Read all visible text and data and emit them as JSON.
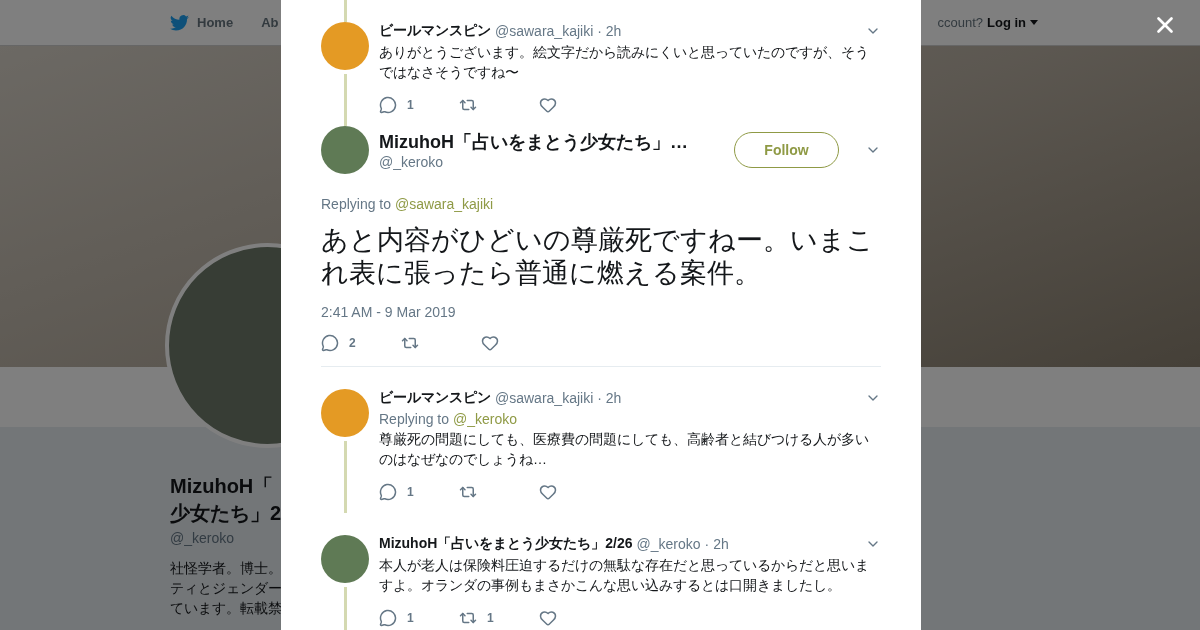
{
  "background": {
    "nav": {
      "home": "Home",
      "about": "Ab",
      "account_prompt": "ccount?",
      "login": "Log in"
    },
    "profile": {
      "name_lines": [
        "MizuhoH「",
        "少女たち」2"
      ],
      "handle": "@_keroko",
      "bio_lines": [
        "社怪学者。博士。",
        "ティとジェンダー",
        "ています。転載禁"
      ]
    }
  },
  "tweets": [
    {
      "kind": "reply",
      "color": "#e49a24",
      "thread_above": true,
      "thread_below": true,
      "name": "ビールマンスピン",
      "handle": "@sawara_kajiki",
      "time": "· 2h",
      "text": "ありがとうございます。絵文字だから読みにくいと思っていたのですが、そうではなさそうですね〜",
      "replies": "1"
    },
    {
      "kind": "main",
      "color": "#5f7a55",
      "name": "MizuhoH「占いをまとう少女たち」…",
      "handle": "@_keroko",
      "follow": "Follow",
      "replying_label": "Replying to",
      "replying_handle": "@sawara_kajiki",
      "text": "あと内容がひどいの尊厳死ですねー。いまこれ表に張ったら普通に燃える案件。",
      "timestamp": "2:41 AM - 9 Mar 2019",
      "replies": "2"
    },
    {
      "kind": "reply",
      "color": "#e49a24",
      "thread_above": false,
      "thread_below": true,
      "name": "ビールマンスピン",
      "handle": "@sawara_kajiki",
      "time": "· 2h",
      "replying_label": "Replying to",
      "replying_handle": "@_keroko",
      "text": "尊厳死の問題にしても、医療費の問題にしても、高齢者と結びつける人が多いのはなぜなのでしょうね…",
      "replies": "1"
    },
    {
      "kind": "reply",
      "color": "#5f7a55",
      "thread_above": false,
      "thread_below": true,
      "name": "MizuhoH「占いをまとう少女たち」2/26",
      "handle": "@_keroko",
      "time": "· 2h",
      "text": "本人が老人は保険料圧迫するだけの無駄な存在だと思っているからだと思いますよ。オランダの事例もまさかこんな思い込みするとは口開きましたし。",
      "replies": "1",
      "retweets": "1"
    }
  ]
}
